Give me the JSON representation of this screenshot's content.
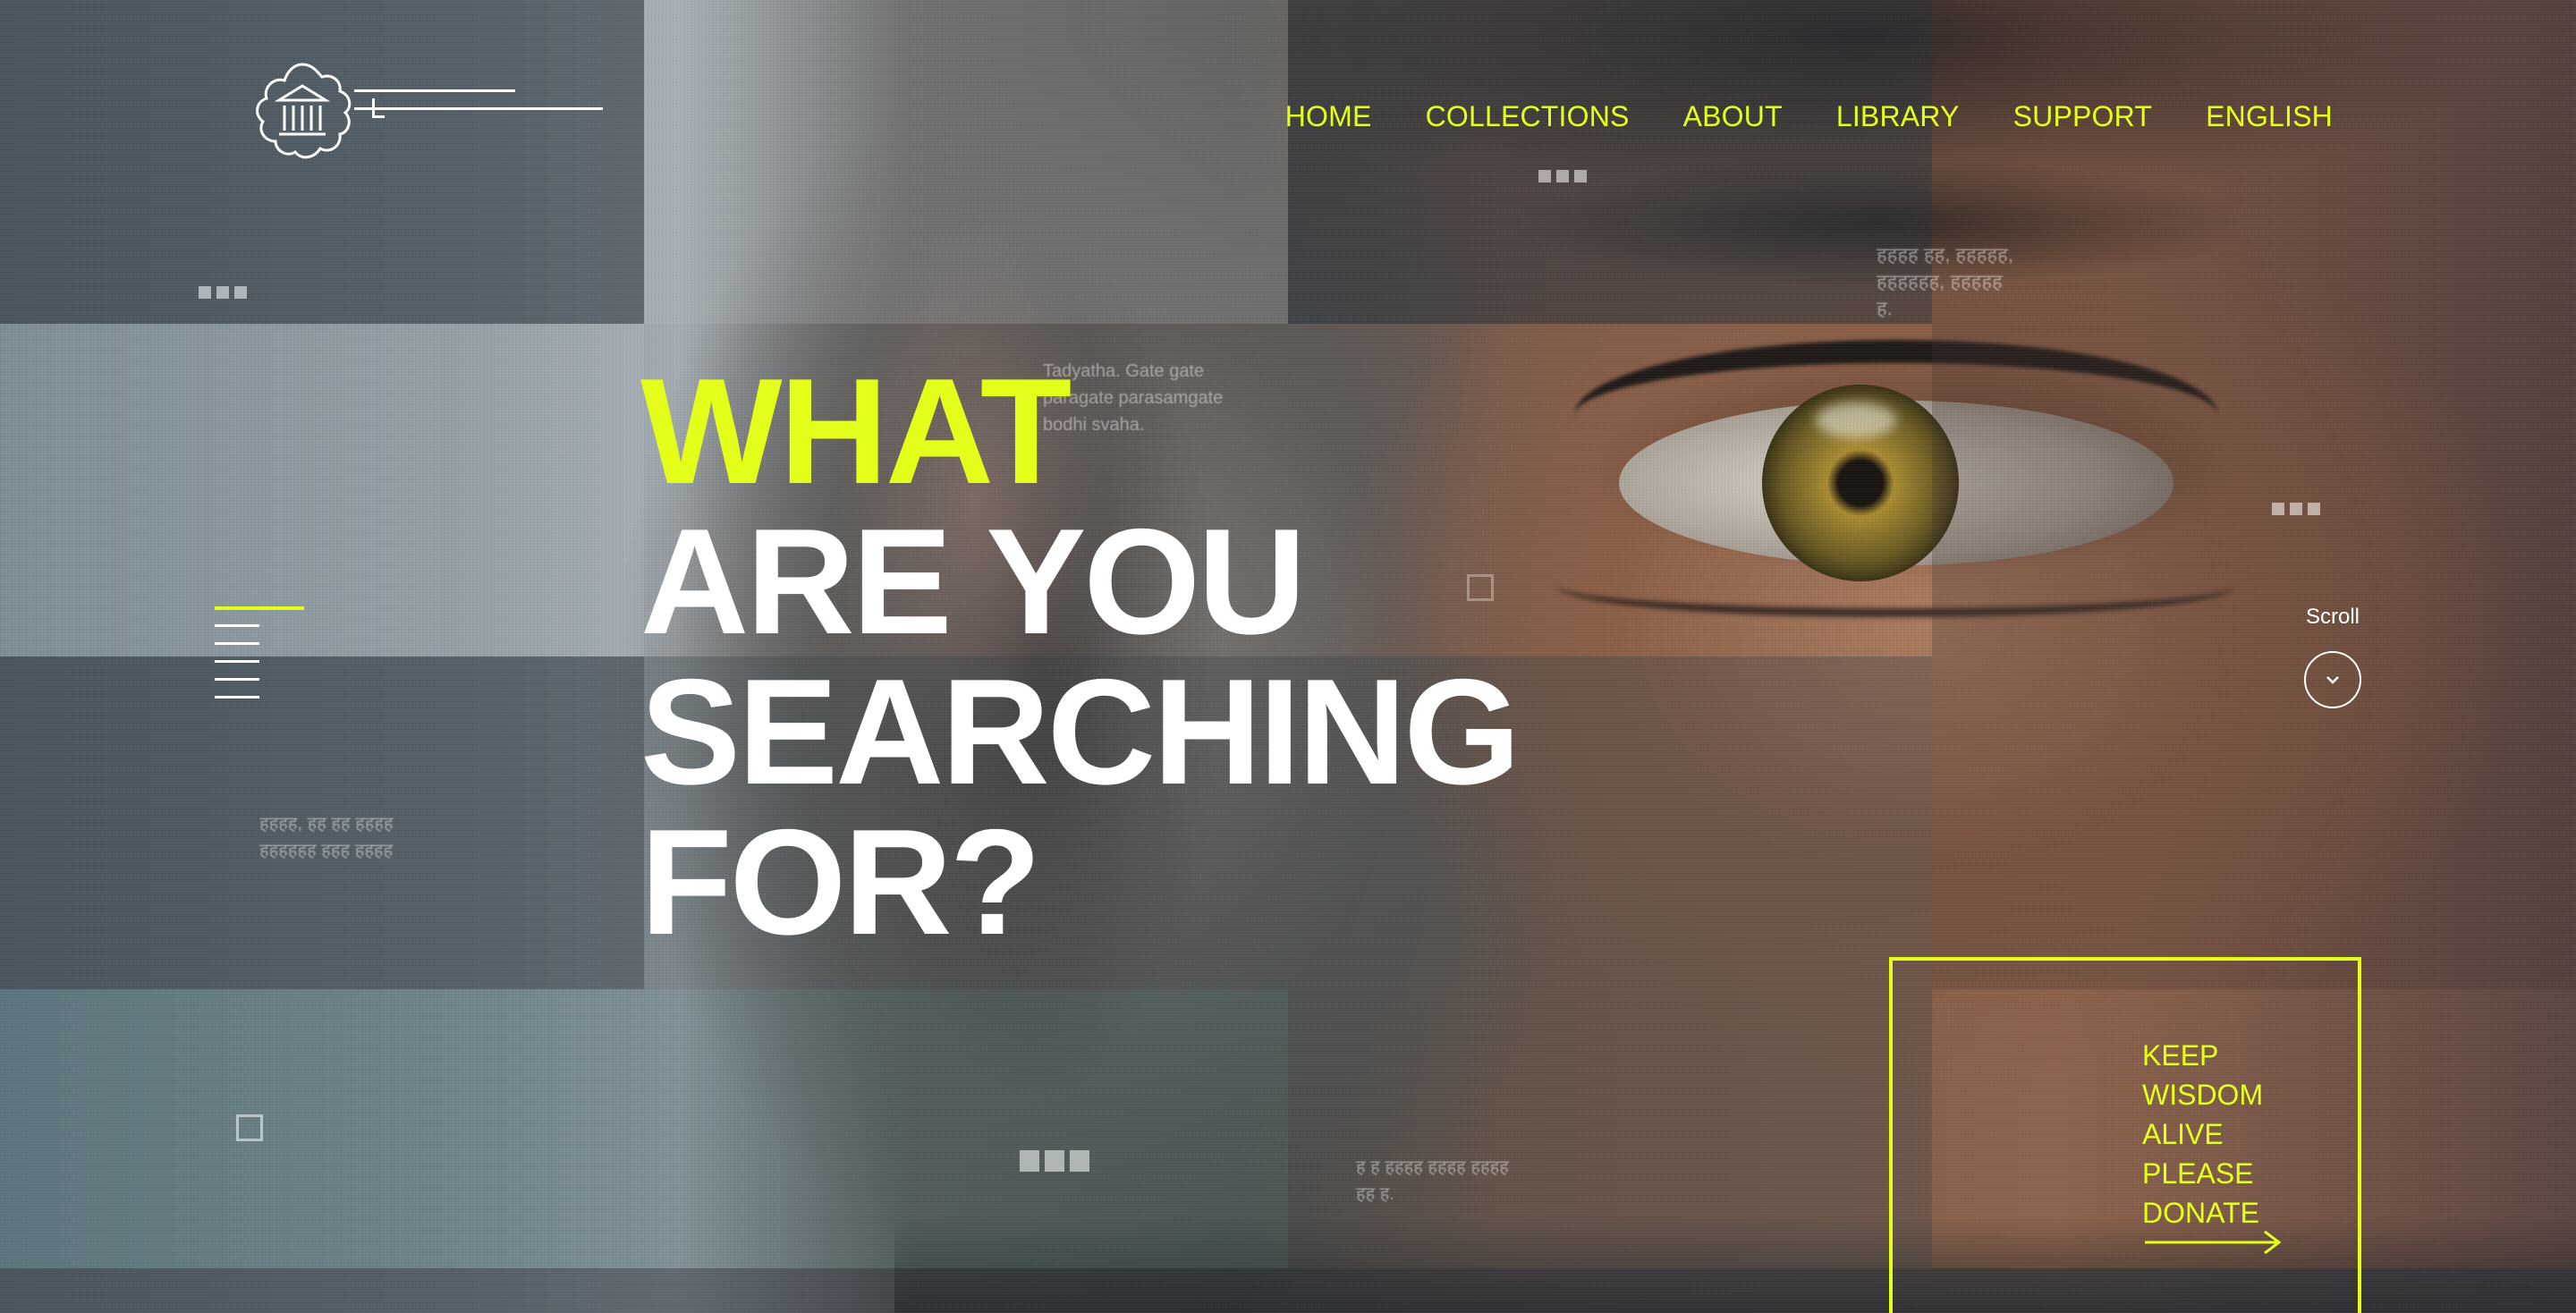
{
  "nav": {
    "items": [
      {
        "label": "HOME"
      },
      {
        "label": "COLLECTIONS"
      },
      {
        "label": "ABOUT"
      },
      {
        "label": "LIBRARY"
      },
      {
        "label": "SUPPORT"
      },
      {
        "label": "ENGLISH"
      }
    ]
  },
  "hero": {
    "line1": "WHAT",
    "line2": "ARE YOU",
    "line3": "SEARCHING",
    "line4": "FOR?"
  },
  "snippets": {
    "mantra": [
      "Tadyatha. Gate gate",
      "paragate parasamgate",
      "bodhi svaha."
    ],
    "top_right": [
      "हहहह हह, हहहहह,",
      "हहहहहह, हहहहह",
      "ह."
    ],
    "left": [
      "हहहह, हह हह हहहह",
      "हहहहहह हहह हहहह"
    ],
    "bottom": [
      "ह ह हहहह हहहह हहहह",
      "हह ह."
    ]
  },
  "scroll": {
    "label": "Scroll"
  },
  "donate": {
    "lines": [
      "KEEP",
      "WISDOM",
      "ALIVE",
      "PLEASE",
      "DONATE"
    ]
  },
  "colors": {
    "accent": "#e4ff1a",
    "text": "#ffffff"
  },
  "icons": {
    "logo": "temple-emblem-icon",
    "menu": "hamburger-menu-icon",
    "scroll": "chevron-down-icon",
    "donate": "arrow-right-icon"
  }
}
